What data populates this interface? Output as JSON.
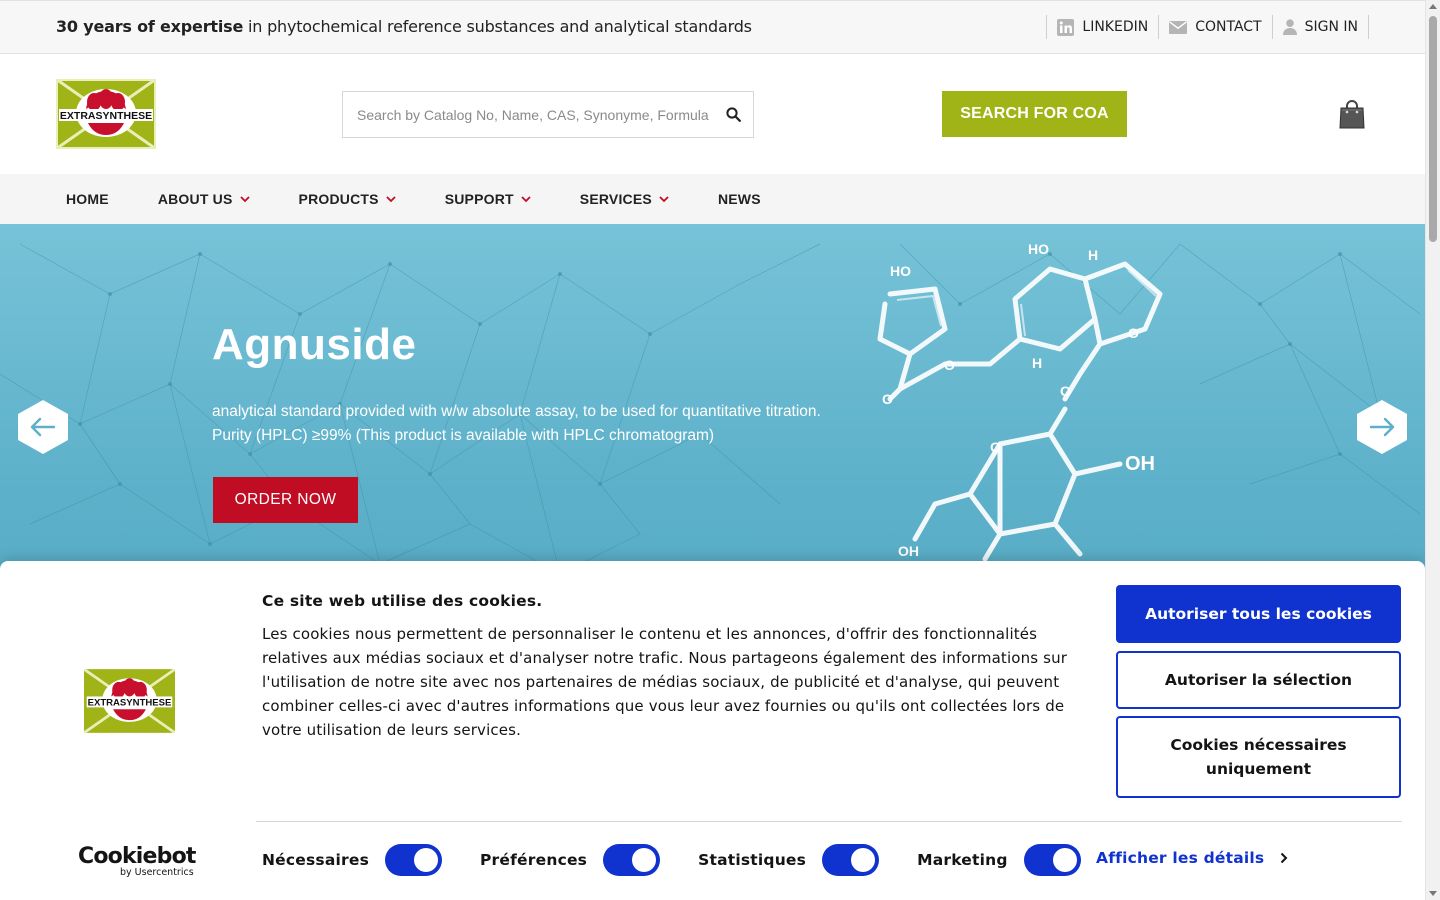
{
  "topbar": {
    "tagline_bold": "30 years of expertise",
    "tagline_rest": " in phytochemical reference substances and analytical standards",
    "links": [
      {
        "label": "LINKEDIN",
        "icon": "linkedin-icon"
      },
      {
        "label": "CONTACT",
        "icon": "envelope-icon"
      },
      {
        "label": "SIGN IN",
        "icon": "user-icon"
      }
    ]
  },
  "header": {
    "logo_text": "EXTRASYNTHESE",
    "search_placeholder": "Search by Catalog No, Name, CAS, Synonyme, Formula",
    "coa_button": "SEARCH FOR COA",
    "cart_icon": "shopping-bag-icon"
  },
  "nav": {
    "items": [
      {
        "label": "HOME",
        "has_dropdown": false
      },
      {
        "label": "ABOUT US",
        "has_dropdown": true
      },
      {
        "label": "PRODUCTS",
        "has_dropdown": true
      },
      {
        "label": "SUPPORT",
        "has_dropdown": true
      },
      {
        "label": "SERVICES",
        "has_dropdown": true
      },
      {
        "label": "NEWS",
        "has_dropdown": false
      }
    ]
  },
  "hero": {
    "title": "Agnuside",
    "desc_line1": "analytical standard provided with w/w absolute assay, to be used for quantitative titration.",
    "desc_line2": "Purity (HPLC) ≥99% (This product is available with HPLC chromatogram)",
    "order_button": "ORDER NOW",
    "molecule_labels": [
      "HO",
      "H",
      "HO",
      "O",
      "O",
      "H",
      "O",
      "O",
      "OH",
      "O",
      "OH"
    ]
  },
  "cookie": {
    "title": "Ce site web utilise des cookies.",
    "text": "Les cookies nous permettent de personnaliser le contenu et les annonces, d'offrir des fonctionnalités relatives aux médias sociaux et d'analyser notre trafic. Nous partageons également des informations sur l'utilisation de notre site avec nos partenaires de médias sociaux, de publicité et d'analyse, qui peuvent combiner celles-ci avec d'autres informations que vous leur avez fournies ou qu'ils ont collectées lors de votre utilisation de leurs services.",
    "btn_allow_all": "Autoriser tous les cookies",
    "btn_allow_selection": "Autoriser la sélection",
    "btn_necessary_only": "Cookies nécessaires uniquement",
    "toggles": [
      {
        "label": "Nécessaires",
        "on": true
      },
      {
        "label": "Préférences",
        "on": true
      },
      {
        "label": "Statistiques",
        "on": true
      },
      {
        "label": "Marketing",
        "on": true
      }
    ],
    "details_link": "Afficher les détails",
    "brand_name": "Cookiebot",
    "brand_by": "by Usercentrics"
  },
  "colors": {
    "accent_green": "#a0b417",
    "order_red": "#c00d23",
    "cookie_blue": "#1032cf",
    "hero_blue": "#5cb0c9"
  }
}
